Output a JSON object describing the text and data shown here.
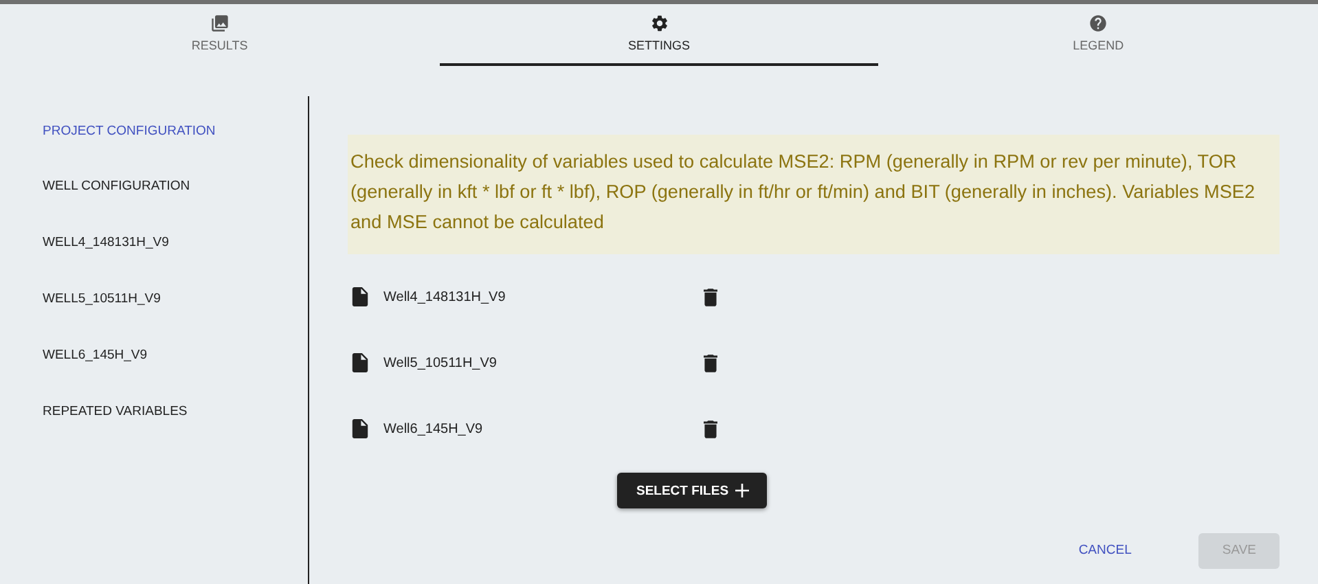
{
  "tabs": [
    {
      "label": "RESULTS",
      "selected": false
    },
    {
      "label": "SETTINGS",
      "selected": true
    },
    {
      "label": "LEGEND",
      "selected": false
    }
  ],
  "sidebar": {
    "items": [
      {
        "label": "PROJECT CONFIGURATION",
        "selected": true
      },
      {
        "label": "WELL CONFIGURATION",
        "selected": false
      },
      {
        "label": "WELL4_148131H_V9",
        "selected": false
      },
      {
        "label": "WELL5_10511H_V9",
        "selected": false
      },
      {
        "label": "WELL6_145H_V9",
        "selected": false
      },
      {
        "label": "REPEATED VARIABLES",
        "selected": false
      }
    ]
  },
  "warning": "Check dimensionality of variables used to calculate MSE2: RPM (generally in RPM or rev per minute), TOR (generally in kft * lbf or ft * lbf), ROP (generally in ft/hr or ft/min) and BIT (generally in inches). Variables MSE2 and MSE cannot be calculated",
  "files": [
    {
      "name": "Well4_148131H_V9"
    },
    {
      "name": "Well5_10511H_V9"
    },
    {
      "name": "Well6_145H_V9"
    }
  ],
  "select_button": {
    "label": "SELECT FILES"
  },
  "actions": {
    "cancel": {
      "label": "CANCEL",
      "disabled": false
    },
    "save": {
      "label": "SAVE",
      "disabled": true
    }
  }
}
